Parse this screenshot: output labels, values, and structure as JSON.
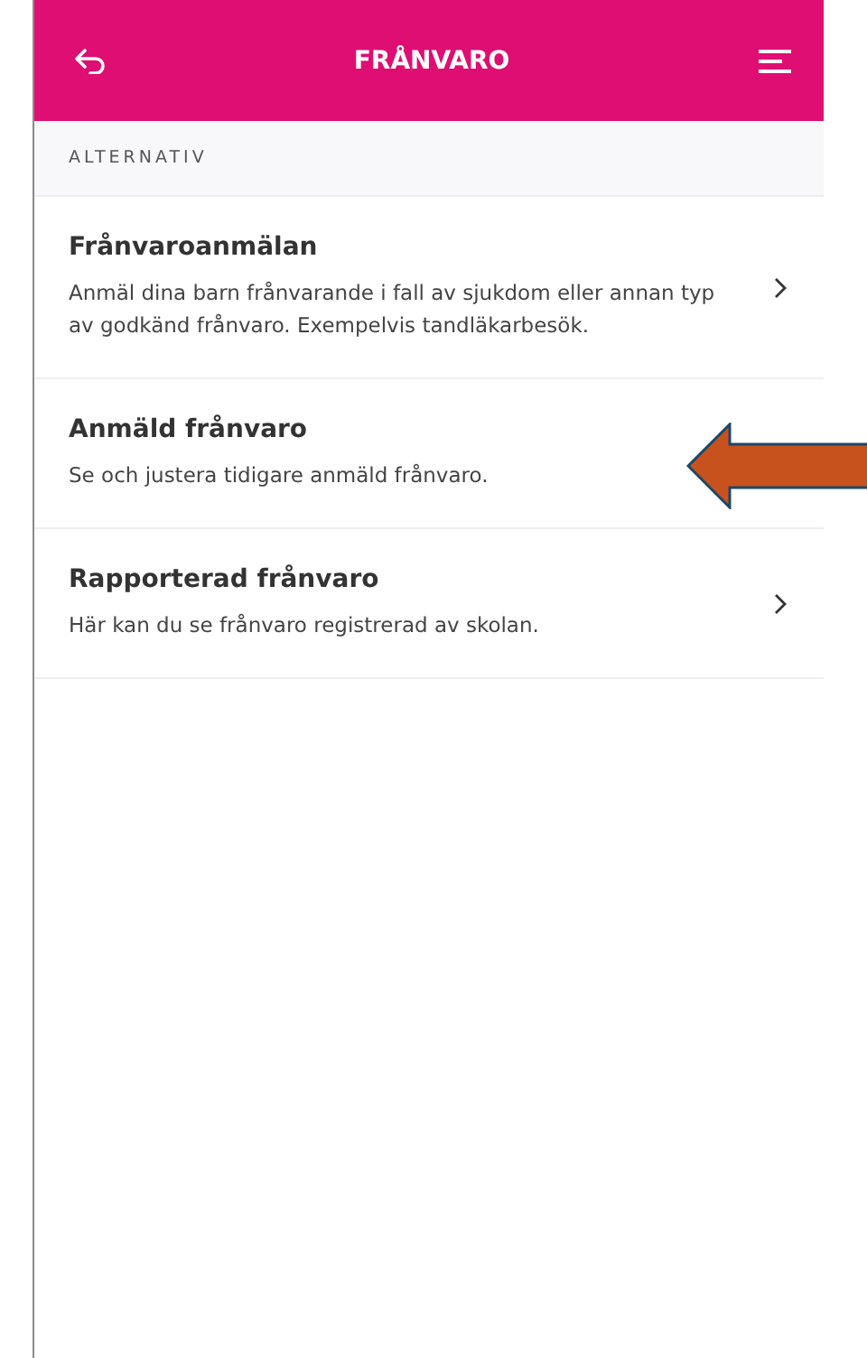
{
  "header": {
    "title": "FRÅNVARO"
  },
  "section": {
    "label": "ALTERNATIV"
  },
  "items": [
    {
      "title": "Frånvaroanmälan",
      "description": "Anmäl dina barn frånvarande i fall av sjukdom eller annan typ av godkänd frånvaro. Exempelvis tandläkarbesök.",
      "chevron": true,
      "pointed": false
    },
    {
      "title": "Anmäld frånvaro",
      "description": "Se och justera tidigare anmäld frånvaro.",
      "chevron": false,
      "pointed": true
    },
    {
      "title": "Rapporterad frånvaro",
      "description": "Här kan du se frånvaro registrerad av skolan.",
      "chevron": true,
      "pointed": false
    }
  ]
}
